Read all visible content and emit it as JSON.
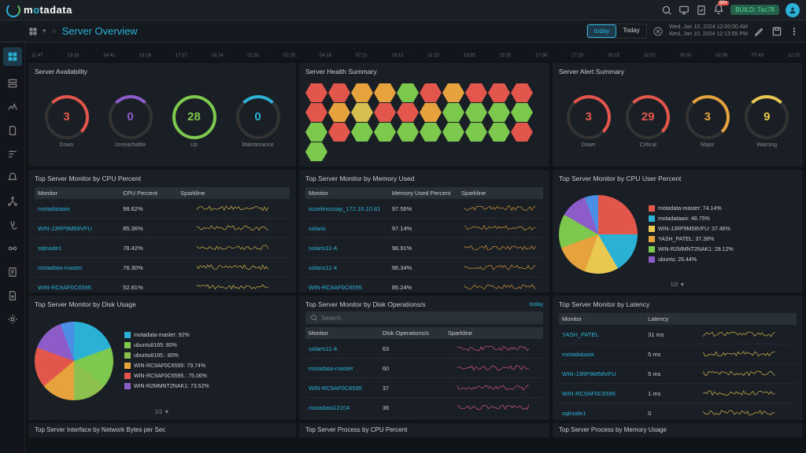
{
  "header": {
    "logo_text_m": "m",
    "logo_text_rest": "tadata",
    "build": "BUILD: 7ac78",
    "notif_count": "99+"
  },
  "sub": {
    "title": "Server Overview",
    "time_pill_today": "today",
    "time_pill_today2": "Today",
    "dt1": "Wed, Jan 10, 2024 12:00:00 AM",
    "dt2": "Wed, Jan 10, 2024 12:13:55 PM"
  },
  "timeline": {
    "labels": [
      "11:47",
      "13:18",
      "14:41",
      "16:16",
      "17:57",
      "19:24",
      "02:31",
      "02:35",
      "04:28",
      "07:21",
      "10:12",
      "11:15",
      "13:05",
      "15:30",
      "17:08",
      "17:20",
      "20:15",
      "22:02",
      "00:00",
      "02:56",
      "07:49",
      "12:13"
    ]
  },
  "availability": {
    "title": "Server Availability",
    "items": [
      {
        "value": "3",
        "label": "Down",
        "color": "red",
        "txt": "#e2564b"
      },
      {
        "value": "0",
        "label": "Unreachable",
        "color": "purple",
        "txt": "#8e5cc9"
      },
      {
        "value": "28",
        "label": "Up",
        "color": "green",
        "txt": "#7cc94e"
      },
      {
        "value": "0",
        "label": "Maintenance",
        "color": "cyan",
        "txt": "#2bb1d6"
      }
    ]
  },
  "health": {
    "title": "Server Health Summary"
  },
  "alerts": {
    "title": "Server Alert Summary",
    "items": [
      {
        "value": "3",
        "label": "Down",
        "color": "red",
        "txt": "#e2564b"
      },
      {
        "value": "29",
        "label": "Critical",
        "color": "red",
        "txt": "#e2564b"
      },
      {
        "value": "3",
        "label": "Major",
        "color": "orange",
        "txt": "#e6a23c"
      },
      {
        "value": "9",
        "label": "Warning",
        "color": "yellow",
        "txt": "#e8c84e"
      }
    ]
  },
  "cpu_table": {
    "title": "Top Server Monitor by CPU Percent",
    "cols": [
      "Monitor",
      "CPU Percent",
      "Sparkline"
    ],
    "rows": [
      {
        "m": "motadataaix",
        "v": "98.62%"
      },
      {
        "m": "WIN-JJRP9M58VFU",
        "v": "85.36%"
      },
      {
        "m": "sqlnode1",
        "v": "78.42%"
      },
      {
        "m": "motadata-master",
        "v": "76.30%"
      },
      {
        "m": "WIN-RC9AF0C6595",
        "v": "52.81%"
      }
    ]
  },
  "mem_table": {
    "title": "Top Server Monitor by Memory Used",
    "cols": [
      "Monitor",
      "Memory Used Percent",
      "Sparkline"
    ],
    "rows": [
      {
        "m": "suselinussap_172.16.10.81",
        "v": "97.56%"
      },
      {
        "m": "solaris",
        "v": "97.14%"
      },
      {
        "m": "solaris11-4.",
        "v": "96.91%"
      },
      {
        "m": "solaris11-4",
        "v": "96.34%"
      },
      {
        "m": "WIN-RC9AF0C6595",
        "v": "85.24%"
      }
    ]
  },
  "cpu_user": {
    "title": "Top Server Monitor by CPU User Percent",
    "legend": [
      {
        "c": "#e2564b",
        "t": "motadata-master: 74.14%"
      },
      {
        "c": "#2bb1d6",
        "t": "motadataaix: 48.75%"
      },
      {
        "c": "#e8c84e",
        "t": "WIN-JJRP9M58VFU: 37.46%"
      },
      {
        "c": "#e6a23c",
        "t": "YASH_PATEL: 37.38%"
      },
      {
        "c": "#7cc94e",
        "t": "WIN-R2MMNT2NAK1: 28.12%"
      },
      {
        "c": "#8e5cc9",
        "t": "ubuntu: 26.44%"
      }
    ],
    "pager": "1/2 ▼"
  },
  "disk_usage": {
    "title": "Top Server Monitor by Disk Usage",
    "legend": [
      {
        "c": "#2bb1d6",
        "t": "motadata-master: 92%"
      },
      {
        "c": "#7cc94e",
        "t": "ubuntu8165: 80%"
      },
      {
        "c": "#8dc04e",
        "t": "ubuntu8165.: 80%"
      },
      {
        "c": "#e6a23c",
        "t": "WIN-RC9AF0C6595: 79.74%"
      },
      {
        "c": "#e2564b",
        "t": "WIN-RC9AF0C6595.: 75.06%"
      },
      {
        "c": "#8e5cc9",
        "t": "WIN-R2MMNT2NAK1: 73.52%"
      }
    ],
    "pager": "1/2 ▼"
  },
  "disk_ops": {
    "title": "Top Server Monitor by Disk Operations/s",
    "today": "today",
    "search_ph": "Search",
    "cols": [
      "Monitor",
      "Disk Operations/s",
      "Sparkline"
    ],
    "rows": [
      {
        "m": "solaris11-4.",
        "v": "63"
      },
      {
        "m": "motadata-master",
        "v": "60"
      },
      {
        "m": "WIN-RC9AF0C6595",
        "v": "37"
      },
      {
        "m": "motadata12104",
        "v": "36"
      }
    ]
  },
  "latency": {
    "title": "Top Server Monitor by Latency",
    "cols": [
      "Monitor",
      "Latency",
      ""
    ],
    "rows": [
      {
        "m": "YASH_PATEL",
        "v": "31 ms"
      },
      {
        "m": "motadataaix",
        "v": "5 ms"
      },
      {
        "m": "WIN-JJRP9M58VFU",
        "v": "5 ms"
      },
      {
        "m": "WIN-RC9AF0C6595",
        "v": "1 ms"
      },
      {
        "m": "sqlnode1",
        "v": "0"
      }
    ]
  },
  "bottom": {
    "p1": "Top Server Interface by Network Bytes per Sec",
    "p2": "Top Server Process by CPU Percent",
    "p3": "Top Server Process by Memory Usage"
  },
  "chart_data": [
    {
      "type": "pie",
      "title": "Top Server Monitor by CPU User Percent",
      "series": [
        {
          "name": "motadata-master",
          "value": 74.14
        },
        {
          "name": "motadataaix",
          "value": 48.75
        },
        {
          "name": "WIN-JJRP9M58VFU",
          "value": 37.46
        },
        {
          "name": "YASH_PATEL",
          "value": 37.38
        },
        {
          "name": "WIN-R2MMNT2NAK1",
          "value": 28.12
        },
        {
          "name": "ubuntu",
          "value": 26.44
        }
      ]
    },
    {
      "type": "pie",
      "title": "Top Server Monitor by Disk Usage",
      "series": [
        {
          "name": "motadata-master",
          "value": 92
        },
        {
          "name": "ubuntu8165",
          "value": 80
        },
        {
          "name": "ubuntu8165.",
          "value": 80
        },
        {
          "name": "WIN-RC9AF0C6595",
          "value": 79.74
        },
        {
          "name": "WIN-RC9AF0C6595.",
          "value": 75.06
        },
        {
          "name": "WIN-R2MMNT2NAK1",
          "value": 73.52
        }
      ]
    }
  ]
}
